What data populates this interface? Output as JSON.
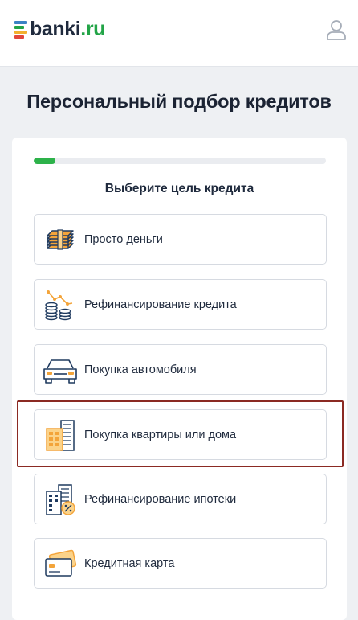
{
  "header": {
    "logo": {
      "name": "banki",
      "tld": ".ru"
    },
    "user_icon": "user-icon"
  },
  "page": {
    "title": "Персональный подбор кредитов"
  },
  "wizard": {
    "progress_fraction": 0.075,
    "question": "Выберите цель кредита",
    "options": [
      {
        "label": "Просто деньги",
        "icon": "money-stack-icon"
      },
      {
        "label": "Рефинансирование кредита",
        "icon": "coins-chart-icon"
      },
      {
        "label": "Покупка автомобиля",
        "icon": "car-icon"
      },
      {
        "label": "Покупка квартиры или дома",
        "icon": "buildings-icon",
        "highlighted": true
      },
      {
        "label": "Рефинансирование ипотеки",
        "icon": "building-percent-icon"
      },
      {
        "label": "Кредитная карта",
        "icon": "credit-card-icon"
      }
    ]
  },
  "colors": {
    "brand_green": "#22a447",
    "progress": "#2db24a",
    "icon_orange": "#f3a43a",
    "icon_navy": "#1f3a5f",
    "highlight": "#8b2a23"
  }
}
